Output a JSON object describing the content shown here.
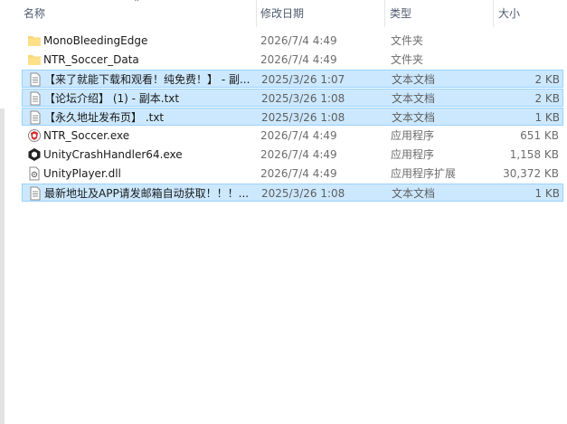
{
  "columns": {
    "name": "名称",
    "date": "修改日期",
    "type": "类型",
    "size": "大小"
  },
  "files": [
    {
      "name": "MonoBleedingEdge",
      "date": "2026/7/4 4:49",
      "type": "文件夹",
      "size": "",
      "icon": "folder-icon",
      "selected": false
    },
    {
      "name": "NTR_Soccer_Data",
      "date": "2026/7/4 4:49",
      "type": "文件夹",
      "size": "",
      "icon": "folder-icon",
      "selected": false
    },
    {
      "name": "【来了就能下载和观看！纯免费！】 - 副...",
      "date": "2025/3/26 1:07",
      "type": "文本文档",
      "size": "2 KB",
      "icon": "text-file-icon",
      "selected": true
    },
    {
      "name": "【论坛介绍】 (1) - 副本.txt",
      "date": "2025/3/26 1:08",
      "type": "文本文档",
      "size": "2 KB",
      "icon": "text-file-icon",
      "selected": true
    },
    {
      "name": "【永久地址发布页】 .txt",
      "date": "2025/3/26 1:08",
      "type": "文本文档",
      "size": "1 KB",
      "icon": "text-file-icon",
      "selected": true
    },
    {
      "name": "NTR_Soccer.exe",
      "date": "2026/7/4 4:49",
      "type": "应用程序",
      "size": "651 KB",
      "icon": "game-exe-icon",
      "selected": false
    },
    {
      "name": "UnityCrashHandler64.exe",
      "date": "2026/7/4 4:49",
      "type": "应用程序",
      "size": "1,158 KB",
      "icon": "unity-exe-icon",
      "selected": false
    },
    {
      "name": "UnityPlayer.dll",
      "date": "2026/7/4 4:49",
      "type": "应用程序扩展",
      "size": "30,372 KB",
      "icon": "dll-file-icon",
      "selected": false
    },
    {
      "name": "最新地址及APP请发邮箱自动获取！！！...",
      "date": "2025/3/26 1:08",
      "type": "文本文档",
      "size": "1 KB",
      "icon": "text-file-icon",
      "selected": true
    }
  ]
}
